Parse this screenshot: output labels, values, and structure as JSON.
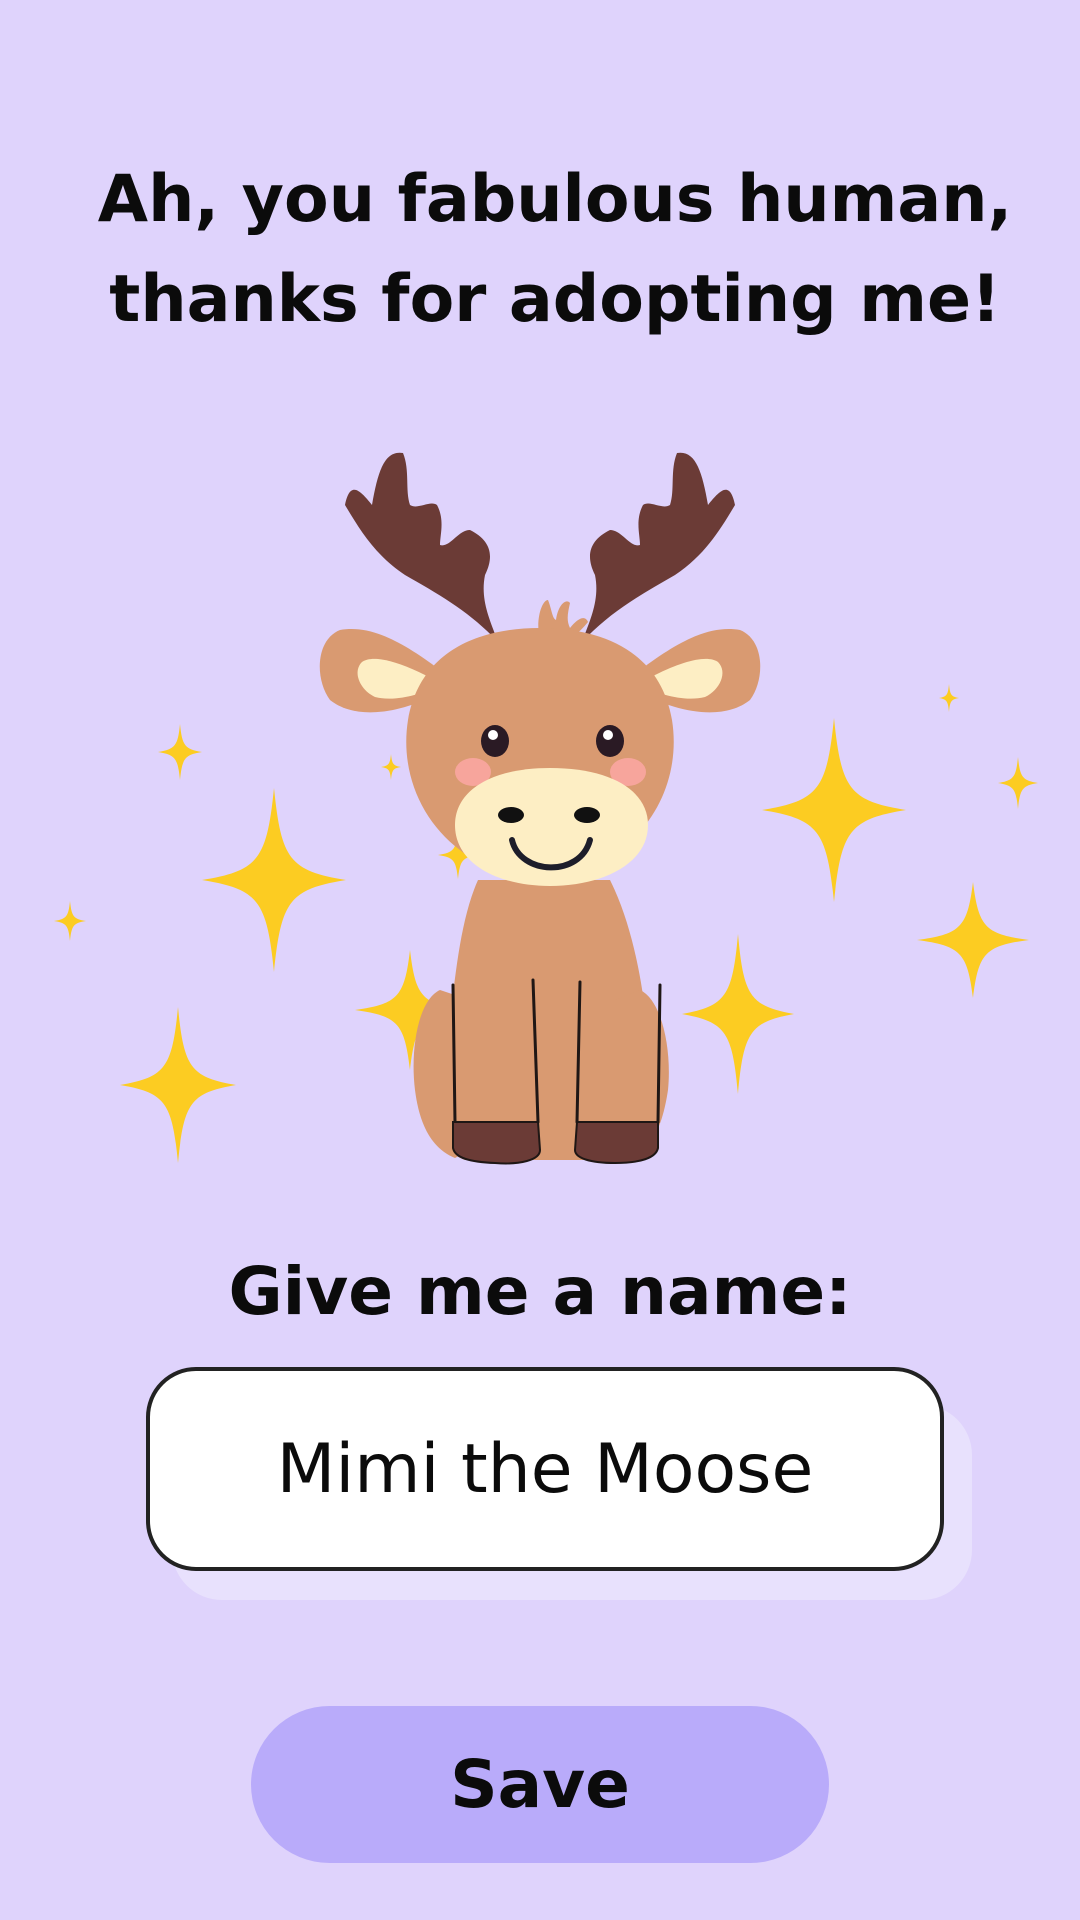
{
  "header": {
    "line1": "Ah, you fabulous human,",
    "line2": "thanks for adopting me!"
  },
  "illustration": {
    "subject": "moose-icon",
    "decoration": "sparkle-icon"
  },
  "name_form": {
    "label": "Give me a name:",
    "value": "Mimi the Moose"
  },
  "actions": {
    "save_label": "Save"
  },
  "colors": {
    "background": "#dfd3fc",
    "button": "#b9abfa",
    "sparkle": "#fccc22",
    "moose_body": "#d99a71",
    "antler": "#6b3b36",
    "muzzle": "#fdeec4"
  }
}
